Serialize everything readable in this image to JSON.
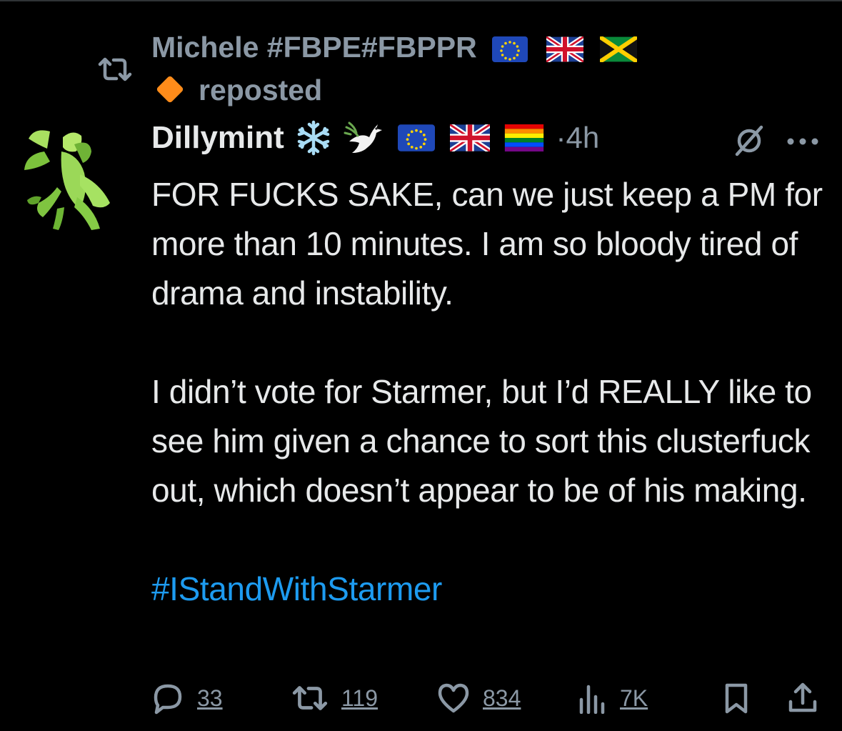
{
  "repost": {
    "reposter_name": "Michele #FBPE#FBPPR",
    "reposted_label": "reposted"
  },
  "tweet": {
    "author": "Dillymint",
    "timestamp": "·4h",
    "paragraphs": [
      "FOR FUCKS SAKE, can we just keep a PM for more than 10 minutes. I am so bloody tired of drama and instability.",
      "I didn’t vote for Starmer, but I’d REALLY like to see him given a chance to sort this clusterfuck out, which doesn’t appear to be of his making."
    ],
    "hashtag": "#IStandWithStarmer"
  },
  "actions": {
    "replies": "33",
    "reposts": "119",
    "likes": "834",
    "views": "7K"
  },
  "colors": {
    "background": "#000000",
    "text": "#e7e9ea",
    "muted": "#8b98a5",
    "link": "#1d9bf0"
  },
  "icons": [
    "repost-icon",
    "orange-diamond-icon",
    "snowflake-emoji",
    "dove-emoji",
    "eu-flag",
    "uk-flag",
    "jamaica-flag",
    "rainbow-flag",
    "muted-icon",
    "more-icon",
    "reply-icon",
    "like-icon",
    "views-icon",
    "bookmark-icon",
    "share-icon"
  ]
}
